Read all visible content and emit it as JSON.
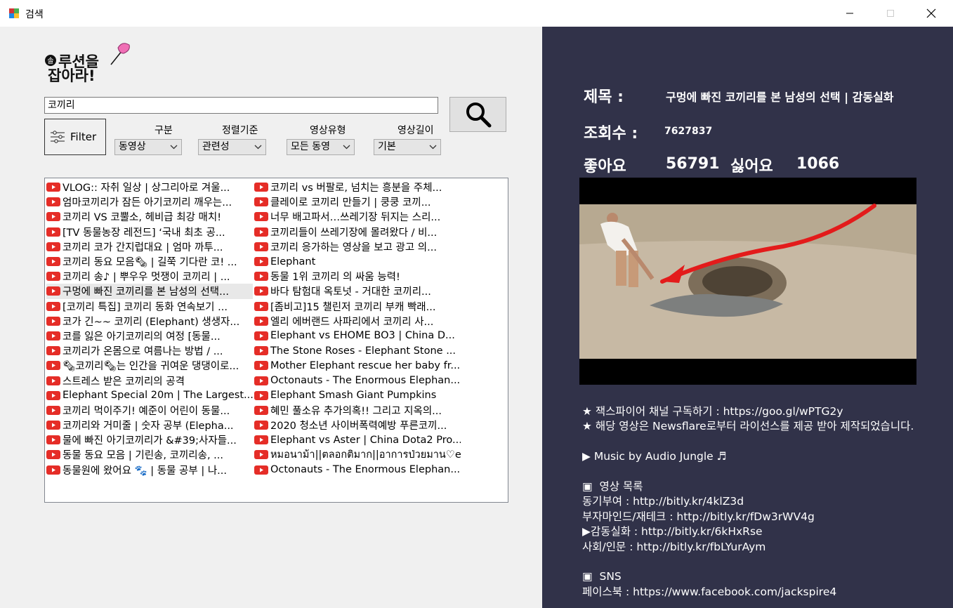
{
  "window": {
    "title": "검색"
  },
  "search": {
    "query": "코끼리"
  },
  "filter": {
    "button_label": "Filter",
    "type_label": "구분",
    "type_value": "동영상",
    "sort_label": "정렬기준",
    "sort_value": "관련성",
    "videotype_label": "영상유형",
    "videotype_value": "모든 동영",
    "length_label": "영상길이",
    "length_value": "기본"
  },
  "results": {
    "left": [
      "VLOG:: 자취 일상 | 상그리아로 겨울...",
      "엄마코끼리가 잠든 아기코끼리 깨우는...",
      "코끼리 VS 코뿔소, 헤비급 최강 매치!",
      "[TV 동물농장 레전드] ‘국내 최초 공...",
      "코끼리 코가 간지럽대요 | 엄마 까투...",
      "코끼리 동요 모음🗞 | 길쭉 기다란 코! ...",
      "코끼리 송♪ | 뿌우우 멋쟁이 코끼리 | ...",
      "구멍에 빠진 코끼리를 본 남성의 선택...",
      "[코끼리 특집] 코끼리 동화 연속보기 ...",
      "코가 긴~~ 코끼리 (Elephant) 생생자...",
      "코를 잃은 아기코끼리의 여정 [동물...",
      "코끼리가 온몸으로 여름나는 방법 / ...",
      "🗞코끼리🗞는 인간을 귀여운 댕댕이로...",
      "스트레스 받은 코끼리의 공격",
      "Elephant Special 20m | The Largest...",
      "코끼리 먹이주기! 예준이 어린이 동물...",
      "코끼리와 거미줄 | 숫자 공부 (Elepha...",
      "물에 빠진 아기코끼리가 &#39;사자들...",
      "동물 동요 모음 | 기린송, 코끼리송, ...",
      "동물원에 왔어요 🐾 | 동물 공부 | 나..."
    ],
    "right": [
      "코끼리 vs 버팔로, 넘치는 흥분을 주체...",
      "클레이로 코끼리 만들기 | 쿵쿵 코끼...",
      "너무 배고파서…쓰레기장 뒤지는 스리...",
      "코끼리들이 쓰레기장에 몰려왔다 / 비...",
      "코끼리 응가하는 영상을 보고 광고 의...",
      "Elephant",
      "동물 1위 코끼리 의 싸움 능력!",
      "바다 탐험대 옥토넛 - 거대한 코끼리...",
      "[좀비고]15 챌린저 코끼리 부캐 빡래...",
      "엘리 에버랜드 사파리에서 코끼리 사...",
      "Elephant vs EHOME BO3 | China D...",
      "The Stone Roses - Elephant Stone ...",
      "Mother Elephant rescue her baby fr...",
      "Octonauts - The Enormous Elephan...",
      "Elephant Smash Giant Pumpkins",
      "혜민 풀소유 추가의혹!! 그리고 지옥의...",
      "2020 청소년 사이버폭력예방 푸른코끼...",
      "Elephant vs Aster | China Dota2 Pro...",
      "หมอนาม้า||ตลอกติมาก||อาการป่วยมาน♡elephant",
      "Octonauts - The Enormous Elephan..."
    ]
  },
  "detail": {
    "title_label": "제목 :",
    "title_value": "구멍에 빠진 코끼리를 본 남성의 선택 | 감동실화",
    "views_label": "조회수 :",
    "views_value": "7627837",
    "likes_label": "좋아요",
    "likes_value": "56791",
    "dislikes_label": "싫어요",
    "dislikes_value": "1066",
    "description": "★ 잭스파이어 채널 구독하기 : https://goo.gl/wPTG2y\n★ 해당 영상은 Newsflare로부터 라이선스를 제공 받아 제작되었습니다.\n\n▶ Music by Audio Jungle ♬\n\n▣  영상 목록\n동기부여 : http://bitly.kr/4klZ3d\n부자마인드/재테크 : http://bitly.kr/fDw3rWV4g\n▶감동실화 : http://bitly.kr/6kHxRse\n사회/인문 : http://bitly.kr/fbLYurAym\n\n▣  SNS\n페이스북 : https://www.facebook.com/jackspire4"
  },
  "colors": {
    "panel_bg": "#313249",
    "youtube_red": "#e52d27"
  }
}
